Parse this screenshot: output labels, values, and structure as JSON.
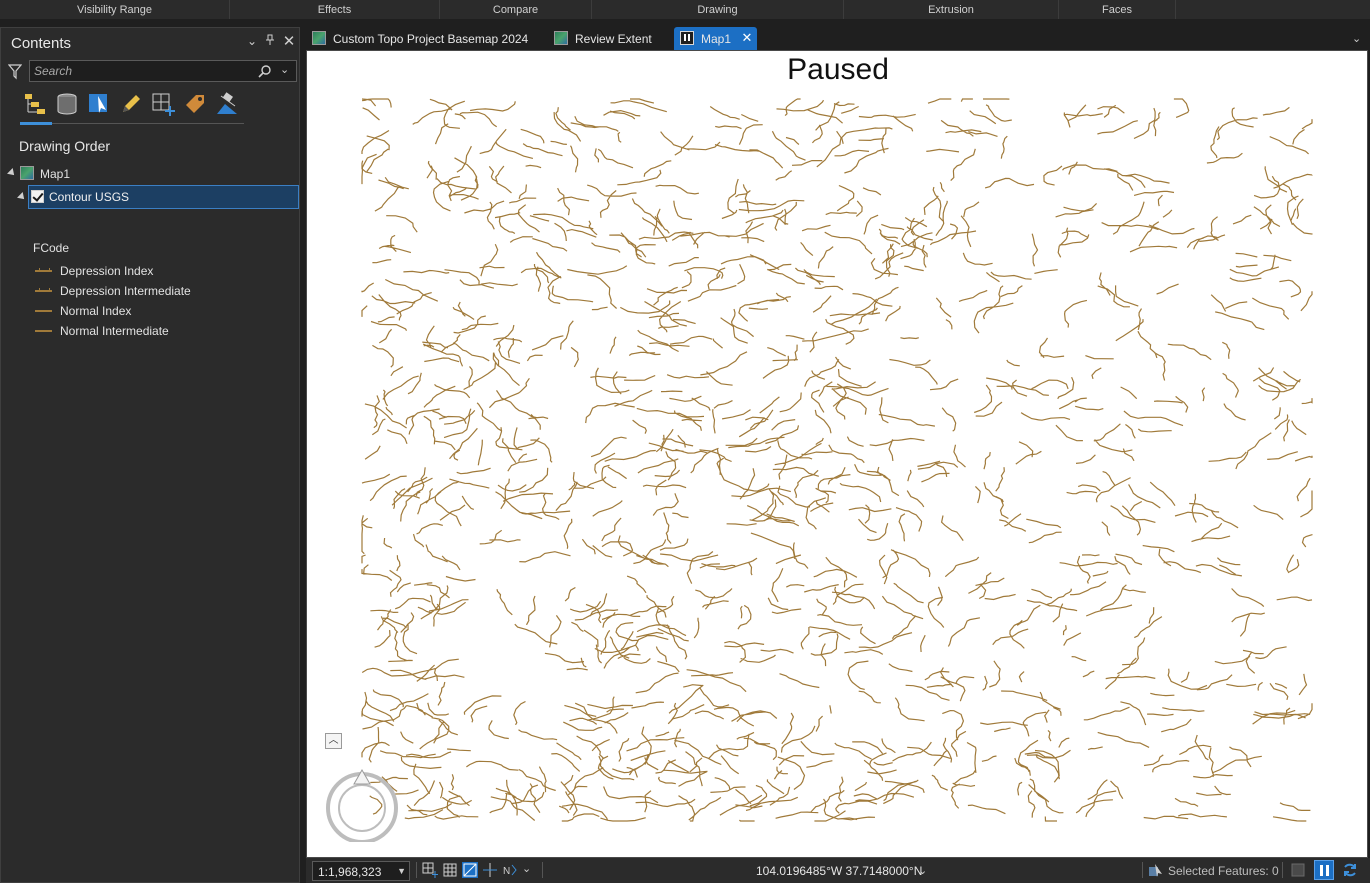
{
  "ribbon_groups": [
    "Visibility Range",
    "Effects",
    "Compare",
    "Drawing",
    "Extrusion",
    "Faces"
  ],
  "contents": {
    "title": "Contents",
    "search_placeholder": "Search",
    "view_icons": [
      "list-by-drawing-order-icon",
      "list-by-data-source-icon",
      "list-by-selection-icon",
      "list-by-editing-icon",
      "list-by-snapping-icon",
      "list-by-labeling-icon",
      "list-by-perspective-imagery-icon"
    ],
    "section": "Drawing Order",
    "map_name": "Map1",
    "layer_name": "Contour USGS",
    "legend_heading": "FCode",
    "legend_items": [
      "Depression Index",
      "Depression Intermediate",
      "Normal Index",
      "Normal Intermediate"
    ]
  },
  "tabs": [
    {
      "label": "Custom Topo Project Basemap 2024"
    },
    {
      "label": "Review Extent"
    },
    {
      "label": "Map1",
      "active": true
    }
  ],
  "map": {
    "overlay_text": "Paused",
    "contour_color": "#a07a3a"
  },
  "status": {
    "scale": "1:1,968,323",
    "coordinates": "104.0196485°W 37.7148000°N",
    "selected_features": "Selected Features: 0"
  },
  "colors": {
    "accent": "#1c6fc4",
    "pane_bg": "#2b2b2b",
    "app_bg": "#1f1f1f"
  }
}
